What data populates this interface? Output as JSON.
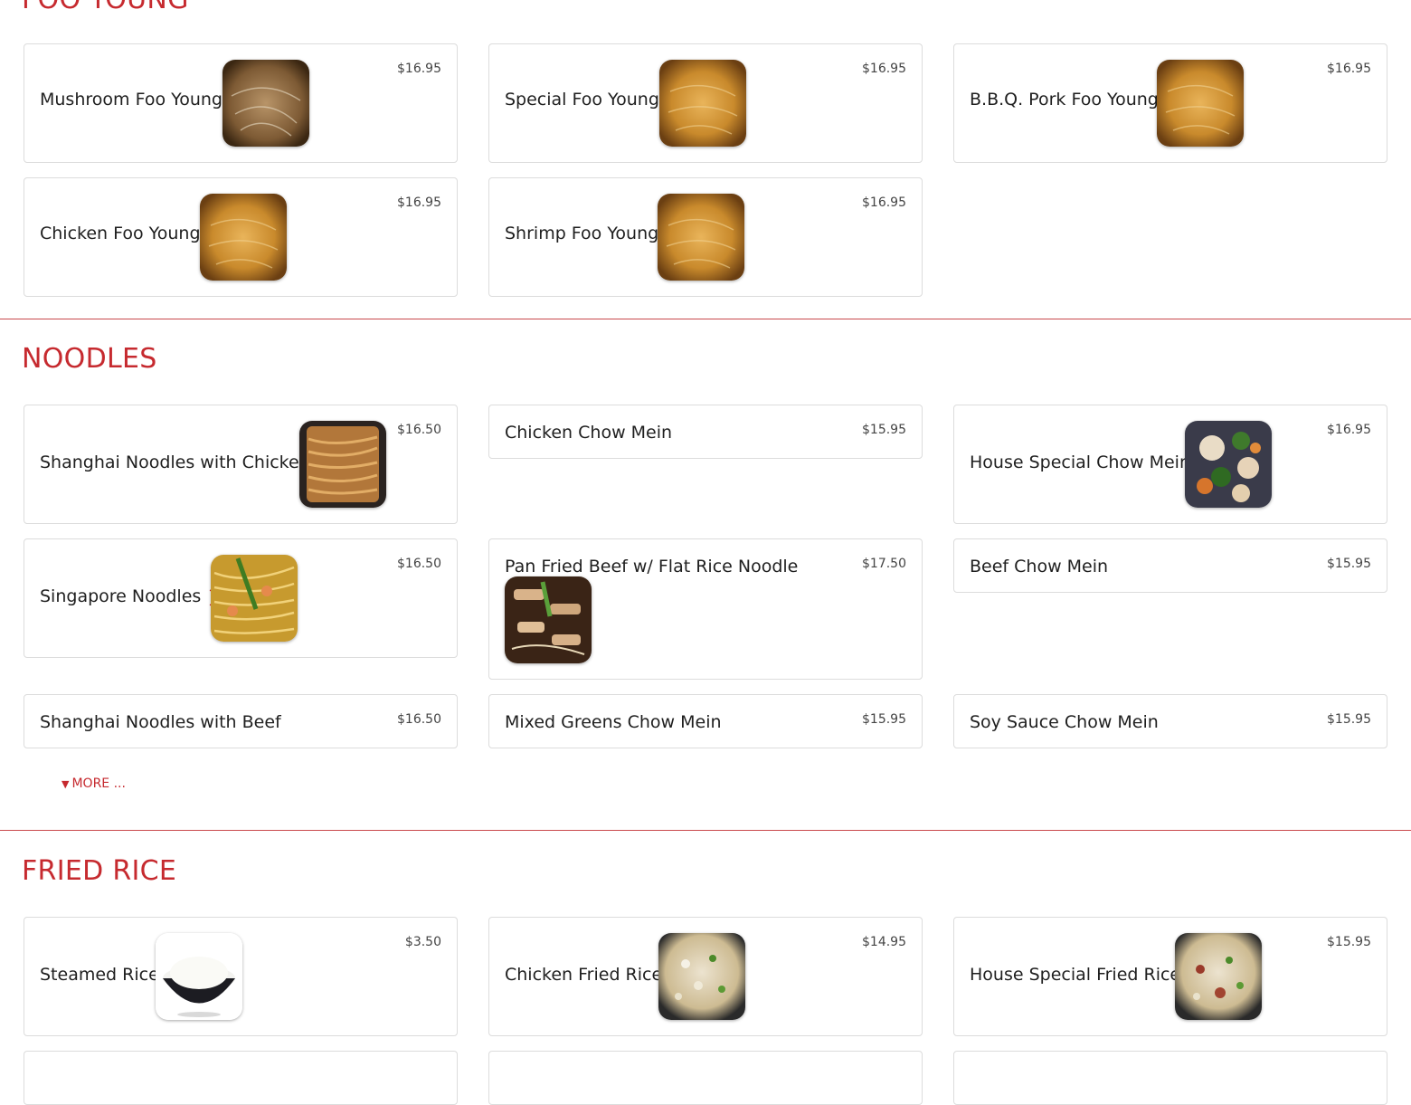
{
  "sections": {
    "foo_young": {
      "title": "FOO YOUNG"
    },
    "noodles": {
      "title": "NOODLES",
      "more_label": "MORE ..."
    },
    "fried_rice": {
      "title": "FRIED RICE"
    }
  },
  "items": {
    "mushroom_foo_young": {
      "name": "Mushroom Foo Young",
      "price": "$16.95",
      "image": "egg-omelette"
    },
    "special_foo_young": {
      "name": "Special Foo Young",
      "price": "$16.95",
      "image": "egg-omelette"
    },
    "bbq_pork_foo_young": {
      "name": "B.B.Q. Pork Foo Young",
      "price": "$16.95",
      "image": "egg-omelette"
    },
    "chicken_foo_young": {
      "name": "Chicken Foo Young",
      "price": "$16.95",
      "image": "egg-omelette"
    },
    "shrimp_foo_young": {
      "name": "Shrimp Foo Young",
      "price": "$16.95",
      "image": "egg-omelette"
    },
    "shanghai_noodles_chicken": {
      "name": "Shanghai Noodles with Chicken",
      "price": "$16.50",
      "image": "noodles"
    },
    "chicken_chow_mein": {
      "name": "Chicken Chow Mein",
      "price": "$15.95"
    },
    "house_special_chow_mein": {
      "name": "House Special Chow Mein",
      "price": "$16.95",
      "image": "mixed-vegetables"
    },
    "singapore_noodles": {
      "name": "Singapore Noodles",
      "price": "$16.50",
      "image": "curry-noodles",
      "spicy_icon": "chili-pepper"
    },
    "pan_fried_beef": {
      "name": "Pan Fried Beef w/ Flat Rice Noodle",
      "price": "$17.50",
      "image": "flat-noodles"
    },
    "beef_chow_mein": {
      "name": "Beef Chow Mein",
      "price": "$15.95"
    },
    "shanghai_noodles_beef": {
      "name": "Shanghai Noodles with Beef",
      "price": "$16.50"
    },
    "mixed_greens_chow_mein": {
      "name": "Mixed Greens Chow Mein",
      "price": "$15.95"
    },
    "soy_sauce_chow_mein": {
      "name": "Soy Sauce Chow Mein",
      "price": "$15.95"
    },
    "steamed_rice": {
      "name": "Steamed Rice",
      "price": "$3.50",
      "image": "rice-bowl"
    },
    "chicken_fried_rice": {
      "name": "Chicken Fried Rice",
      "price": "$14.95",
      "image": "fried-rice"
    },
    "house_special_fried_rice": {
      "name": "House Special Fried Rice",
      "price": "$15.95",
      "image": "fried-rice"
    }
  },
  "colors": {
    "accent": "#c62a2f",
    "card_border": "#dcdcdc",
    "text": "#1f1f1f"
  }
}
